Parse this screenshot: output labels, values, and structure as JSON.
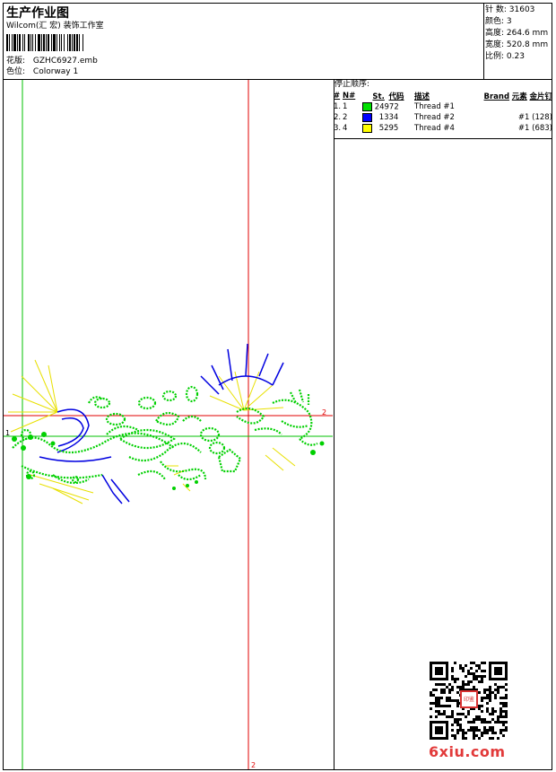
{
  "header": {
    "title": "生产作业图",
    "company": "Wilcom(汇 宏) 装饰工作室",
    "design_label": "花版:",
    "design_value": "GZHC6927.emb",
    "colorway_label": "色位:",
    "colorway_value": "Colorway 1"
  },
  "stats": [
    {
      "label": "针 数:",
      "value": "31603"
    },
    {
      "label": "颜色:",
      "value": "3"
    },
    {
      "label": "高度:",
      "value": "264.6 mm"
    },
    {
      "label": "宽度:",
      "value": "520.8 mm"
    },
    {
      "label": "比例:",
      "value": "0.23"
    }
  ],
  "stop_sequence": {
    "title": "停止顺序:",
    "headers": {
      "num": "#",
      "n": "N#",
      "st": "St.",
      "code": "代码",
      "desc": "描述",
      "brand": "Brand",
      "element": "元素",
      "sequin": "金片钉"
    },
    "rows": [
      {
        "num": "1.",
        "n": "1",
        "color": "#00e000",
        "st": "24972",
        "desc": "Thread #1",
        "sequin": ""
      },
      {
        "num": "2.",
        "n": "2",
        "color": "#0000ff",
        "st": "1334",
        "desc": "Thread #2",
        "sequin": "#1 (128)"
      },
      {
        "num": "3.",
        "n": "4",
        "color": "#ffff00",
        "st": "5295",
        "desc": "Thread #4",
        "sequin": "#1 (683)"
      }
    ]
  },
  "canvas": {
    "guide_color_green": "#00c000",
    "guide_color_red": "#e00000",
    "marker_1": "1",
    "marker_2": "2"
  },
  "watermark": {
    "text": "6xiu.com",
    "seal_text": "印鉴"
  }
}
